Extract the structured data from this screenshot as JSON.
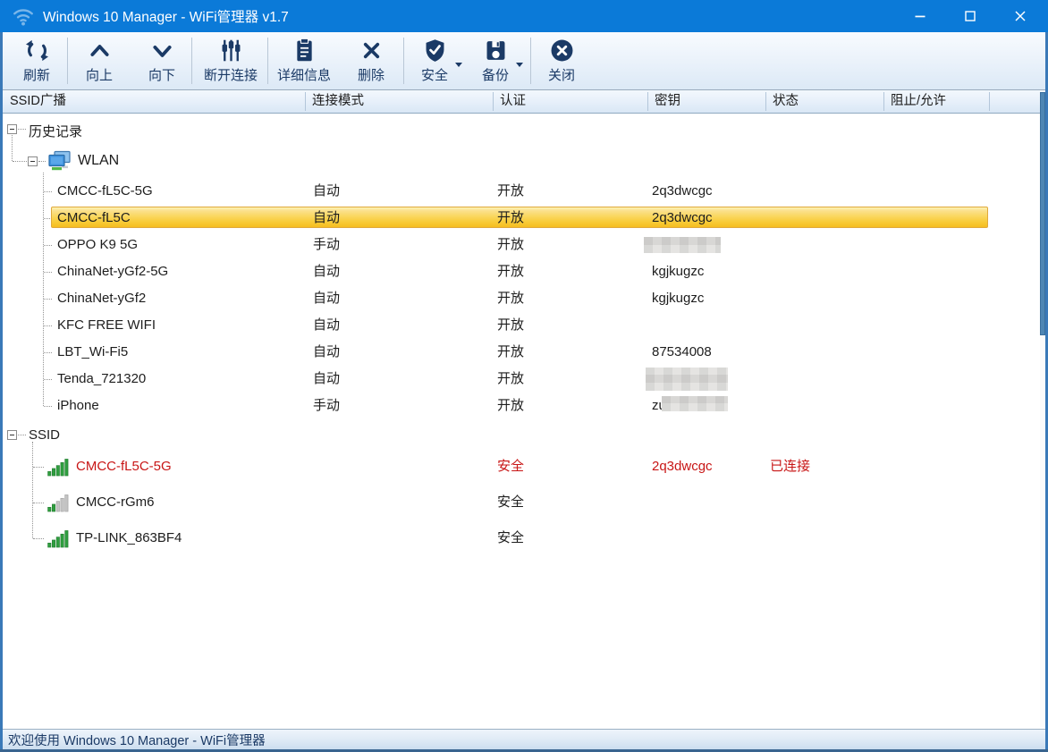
{
  "window": {
    "title": "Windows 10 Manager - WiFi管理器 v1.7"
  },
  "toolbar": {
    "buttons": [
      {
        "label": "刷新"
      },
      {
        "label": "向上"
      },
      {
        "label": "向下"
      },
      {
        "label": "断开连接"
      },
      {
        "label": "详细信息"
      },
      {
        "label": "删除"
      },
      {
        "label": "安全",
        "has_dropdown": true
      },
      {
        "label": "备份",
        "has_dropdown": true
      },
      {
        "label": "关闭"
      }
    ]
  },
  "table": {
    "headers": [
      "SSID广播",
      "连接模式",
      "认证",
      "密钥",
      "状态",
      "阻止/允许"
    ]
  },
  "tree": {
    "history": "历史记录",
    "wlan": "WLAN",
    "ssid": "SSID"
  },
  "history_rows": [
    {
      "ssid": "CMCC-fL5C-5G",
      "mode": "自动",
      "auth": "开放",
      "key": "2q3dwcgc"
    },
    {
      "ssid": "CMCC-fL5C",
      "mode": "自动",
      "auth": "开放",
      "key": "2q3dwcgc",
      "selected": true
    },
    {
      "ssid": "OPPO K9 5G",
      "mode": "手动",
      "auth": "开放",
      "key": "",
      "key_redacted": true
    },
    {
      "ssid": "ChinaNet-yGf2-5G",
      "mode": "自动",
      "auth": "开放",
      "key": "kgjkugzc"
    },
    {
      "ssid": "ChinaNet-yGf2",
      "mode": "自动",
      "auth": "开放",
      "key": "kgjkugzc"
    },
    {
      "ssid": "KFC FREE WIFI",
      "mode": "自动",
      "auth": "开放",
      "key": ""
    },
    {
      "ssid": "LBT_Wi-Fi5",
      "mode": "自动",
      "auth": "开放",
      "key": "87534008"
    },
    {
      "ssid": "Tenda_721320",
      "mode": "自动",
      "auth": "开放",
      "key": "",
      "key_redacted": true
    },
    {
      "ssid": "iPhone",
      "mode": "手动",
      "auth": "开放",
      "key": "zu",
      "key_redacted": true
    }
  ],
  "ssid_rows": [
    {
      "ssid": "CMCC-fL5C-5G",
      "auth": "安全",
      "key": "2q3dwcgc",
      "status": "已连接",
      "connected": true,
      "signal": "strong"
    },
    {
      "ssid": "CMCC-rGm6",
      "auth": "安全",
      "key": "",
      "status": "",
      "signal": "weak"
    },
    {
      "ssid": "TP-LINK_863BF4",
      "auth": "安全",
      "key": "",
      "status": "",
      "signal": "strong"
    }
  ],
  "status_bar": {
    "text": "欢迎使用 Windows 10 Manager - WiFi管理器"
  },
  "colors": {
    "titlebar_blue": "#0b7ad8",
    "toolbar_navy": "#1b3a66",
    "selected_row_yellow": "#f8ca36",
    "connected_red": "#c81616",
    "signal_green": "#2f9e3f"
  }
}
